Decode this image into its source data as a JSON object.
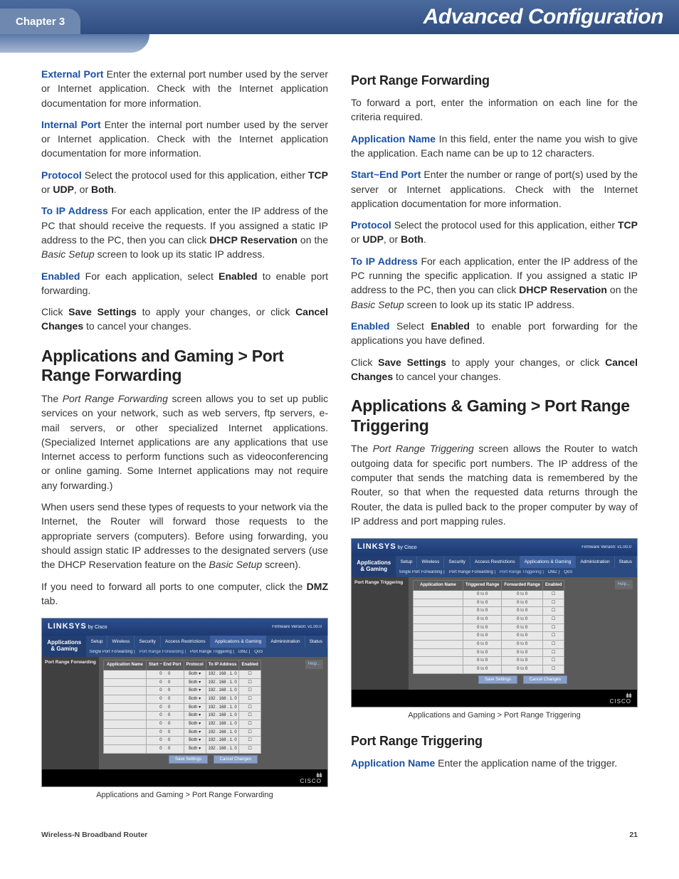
{
  "header": {
    "chapter": "Chapter 3",
    "title": "Advanced Configuration"
  },
  "left": {
    "externalPort": {
      "term": "External Port",
      "text": " Enter the external port number used by the server or Internet application. Check with the Internet application documentation for more information."
    },
    "internalPort": {
      "term": "Internal Port",
      "text": " Enter the internal port number used by the server or Internet application. Check with the Internet application documentation for more information."
    },
    "protocol": {
      "term": "Protocol",
      "pre": " Select the protocol used for this application, either ",
      "opt1": "TCP",
      "mid1": " or ",
      "opt2": "UDP",
      "mid2": ", or ",
      "opt3": "Both",
      "end": "."
    },
    "toIp": {
      "term": "To IP Address",
      "pre": " For each application, enter the IP address of the PC that should receive the requests. If you assigned a static IP address to the PC, then you can click ",
      "b1": "DHCP Reservation",
      "mid": " on the ",
      "it": "Basic Setup",
      "end": " screen to look up its static IP address."
    },
    "enabled": {
      "term": "Enabled",
      "pre": " For each application, select ",
      "b1": "Enabled",
      "end": " to enable port forwarding."
    },
    "save": {
      "pre": "Click ",
      "b1": "Save Settings",
      "mid": " to apply your changes, or click ",
      "b2": "Cancel Changes",
      "end": " to cancel your changes."
    },
    "h2": "Applications and Gaming > Port Range Forwarding",
    "p1": {
      "pre": "The ",
      "it": "Port Range Forwarding",
      "rest": " screen allows you to set up public services on your network, such as web servers, ftp servers, e-mail servers, or other specialized Internet applications. (Specialized Internet applications are any applications that use Internet access to perform functions such as videoconferencing or online gaming. Some Internet applications may not require any forwarding.)"
    },
    "p2": {
      "pre": "When users send these types of requests to your network via the Internet, the Router will forward those requests to the appropriate servers (computers). Before using forwarding, you should assign static IP addresses to the designated servers (use the DHCP Reservation feature on the ",
      "it": "Basic Setup",
      "end": " screen)."
    },
    "p3": {
      "pre": "If you need to forward all ports to one computer, click the ",
      "b1": "DMZ",
      "end": " tab."
    },
    "ss": {
      "brand": "LINKSYS",
      "by": "by Cisco",
      "fw": "Firmware Version: v1.00.0",
      "panel": "Applications & Gaming",
      "tabs": [
        "Setup",
        "Wireless",
        "Security",
        "Access Restrictions",
        "Applications & Gaming",
        "Administration",
        "Status"
      ],
      "subtabs": [
        "Single Port Forwarding",
        "Port Range Forwarding",
        "Port Range Triggering",
        "DMZ",
        "QoS"
      ],
      "sideTitle": "Port Range Forwarding",
      "headers": [
        "Application Name",
        "Start ~ End Port",
        "Protocol",
        "To IP Address",
        "Enabled"
      ],
      "rowCount": 10,
      "proto": "Both",
      "ipPrefix": "192 . 168 . 1.",
      "toLabel": "to",
      "zero": "0",
      "help": "Help...",
      "btnSave": "Save Settings",
      "btnCancel": "Cancel Changes",
      "cisco": "CISCO"
    },
    "caption": "Applications and Gaming > Port Range Forwarding"
  },
  "right": {
    "h3a": "Port Range Forwarding",
    "p0": "To forward a port, enter the information on each line for the criteria required.",
    "appName": {
      "term": "Application Name",
      "text": " In this field, enter the name you wish to give the application. Each name can be up to 12 characters."
    },
    "startEnd": {
      "term": "Start~End Port",
      "text": " Enter the number or range of port(s) used by the server or Internet applications. Check with the Internet application documentation for more information."
    },
    "protocol": {
      "term": "Protocol",
      "pre": " Select the protocol used for this application, either ",
      "opt1": "TCP",
      "mid1": " or ",
      "opt2": "UDP",
      "mid2": ", or ",
      "opt3": "Both",
      "end": "."
    },
    "toIp": {
      "term": "To IP Address",
      "pre": " For each application, enter the IP address of the PC running the specific application. If you assigned a static IP address to the PC, then you can click ",
      "b1": "DHCP Reservation",
      "mid": " on the ",
      "it": "Basic Setup",
      "end": " screen to look up its static IP address."
    },
    "enabled": {
      "term": "Enabled",
      "pre": " Select ",
      "b1": "Enabled",
      "end": " to enable port forwarding for the applications you have defined."
    },
    "save": {
      "pre": "Click ",
      "b1": "Save Settings",
      "mid": " to apply your changes, or click ",
      "b2": "Cancel Changes",
      "end": " to cancel your changes."
    },
    "h2": "Applications & Gaming > Port Range Triggering",
    "p1": {
      "pre": "The ",
      "it": "Port Range Triggering",
      "rest": " screen allows the Router to watch outgoing data for specific port numbers. The IP address of the computer that sends the matching data is remembered by the Router, so that when the requested data returns through the Router, the data is pulled back to the proper computer by way of IP address and port mapping rules."
    },
    "ss": {
      "brand": "LINKSYS",
      "by": "by Cisco",
      "fw": "Firmware Version: v1.00.0",
      "panel": "Applications & Gaming",
      "tabs": [
        "Setup",
        "Wireless",
        "Security",
        "Access Restrictions",
        "Applications & Gaming",
        "Administration",
        "Status"
      ],
      "subtabs": [
        "Single Port Forwarding",
        "Port Range Forwarding",
        "Port Range Triggering",
        "DMZ",
        "QoS"
      ],
      "sideTitle": "Port Range Triggering",
      "headers": [
        "Application Name",
        "Triggered Range",
        "Forwarded Range",
        "Enabled"
      ],
      "rowCount": 10,
      "toLabel": "to",
      "zero": "0",
      "help": "Help...",
      "btnSave": "Save Settings",
      "btnCancel": "Cancel Changes",
      "cisco": "CISCO"
    },
    "caption": "Applications and Gaming > Port Range Triggering",
    "h3b": "Port Range Triggering",
    "appName2": {
      "term": "Application Name",
      "text": " Enter the application name of the trigger."
    }
  },
  "footer": {
    "left": "Wireless-N Broadband Router",
    "right": "21"
  }
}
